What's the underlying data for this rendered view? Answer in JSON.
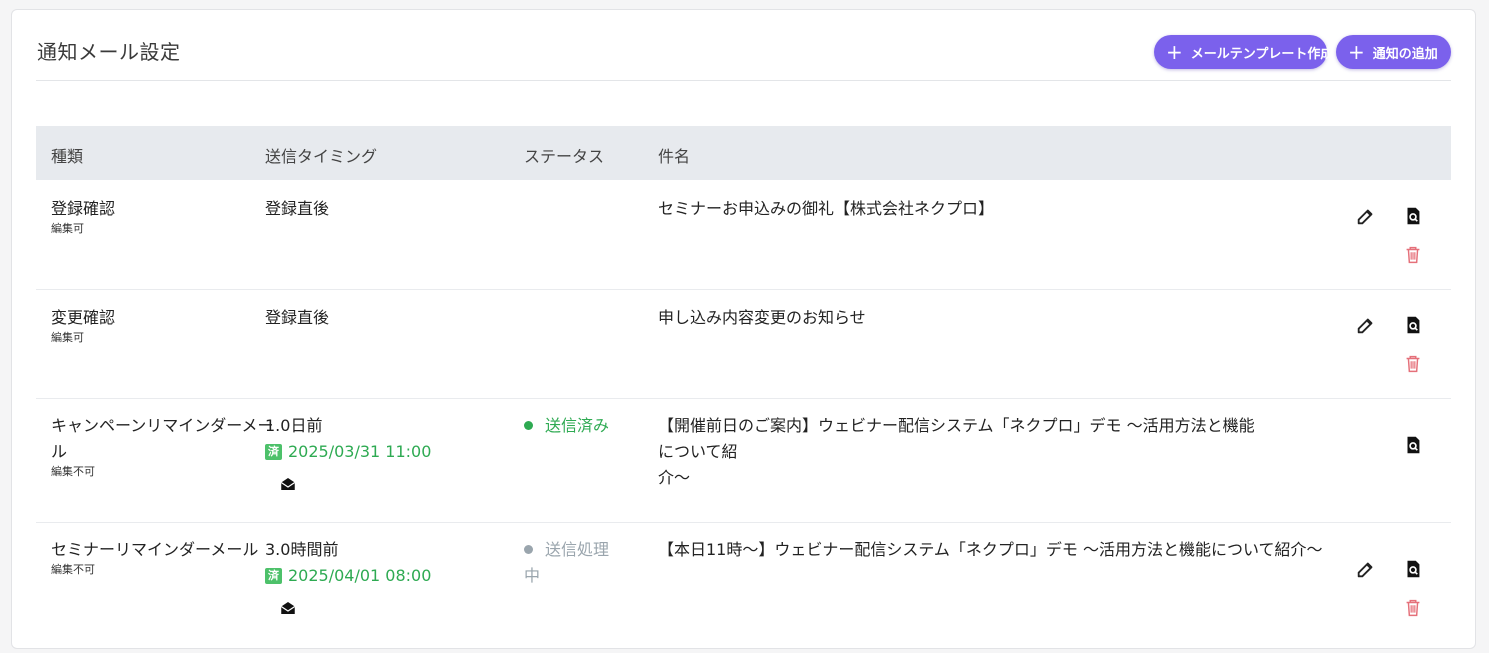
{
  "page": {
    "title": "通知メール設定",
    "template_button": "メールテンプレート作成",
    "add_button": "通知の追加",
    "plus": "+"
  },
  "table": {
    "headers": [
      "種類",
      "送信タイミング",
      "ステータス",
      "件名"
    ],
    "rows": [
      {
        "type": "登録確認",
        "editable": "編集可",
        "timing": "登録直後",
        "subject": "セミナーお申込みの御礼【株式会社ネクプロ】"
      },
      {
        "type": "変更確認",
        "editable": "編集可",
        "timing": "登録直後",
        "subject": "申し込み内容変更のお知らせ"
      },
      {
        "type_line1": "キャンペーンリマインダーメー",
        "type_line2": "ル",
        "editable": "編集不可",
        "timing": "1.0日前",
        "done_badge": "済",
        "sent_at": "2025/03/31 11:00",
        "status": "送信済み",
        "subject_line1": "【開催前日のご案内】ウェビナー配信システム「ネクプロ」デモ ～活用方法と機能について紹",
        "subject_line2": "介～"
      },
      {
        "type": "セミナーリマインダーメール",
        "editable": "編集不可",
        "timing": "3.0時間前",
        "done_badge": "済",
        "sent_at": "2025/04/01 08:00",
        "status_line1": "送信処理",
        "status_line2": "中",
        "subject": "【本日11時～】ウェビナー配信システム「ネクプロ」デモ ～活用方法と機能について紹介～"
      }
    ]
  },
  "colors": {
    "accent": "#7b61ec",
    "sent_green": "#2eaa52",
    "processing_grey": "#9aa5ad",
    "delete_red": "#e5707a"
  },
  "icons": [
    "plus-icon",
    "edit-icon",
    "preview-icon",
    "delete-icon",
    "mail-open-icon",
    "status-dot-icon"
  ]
}
